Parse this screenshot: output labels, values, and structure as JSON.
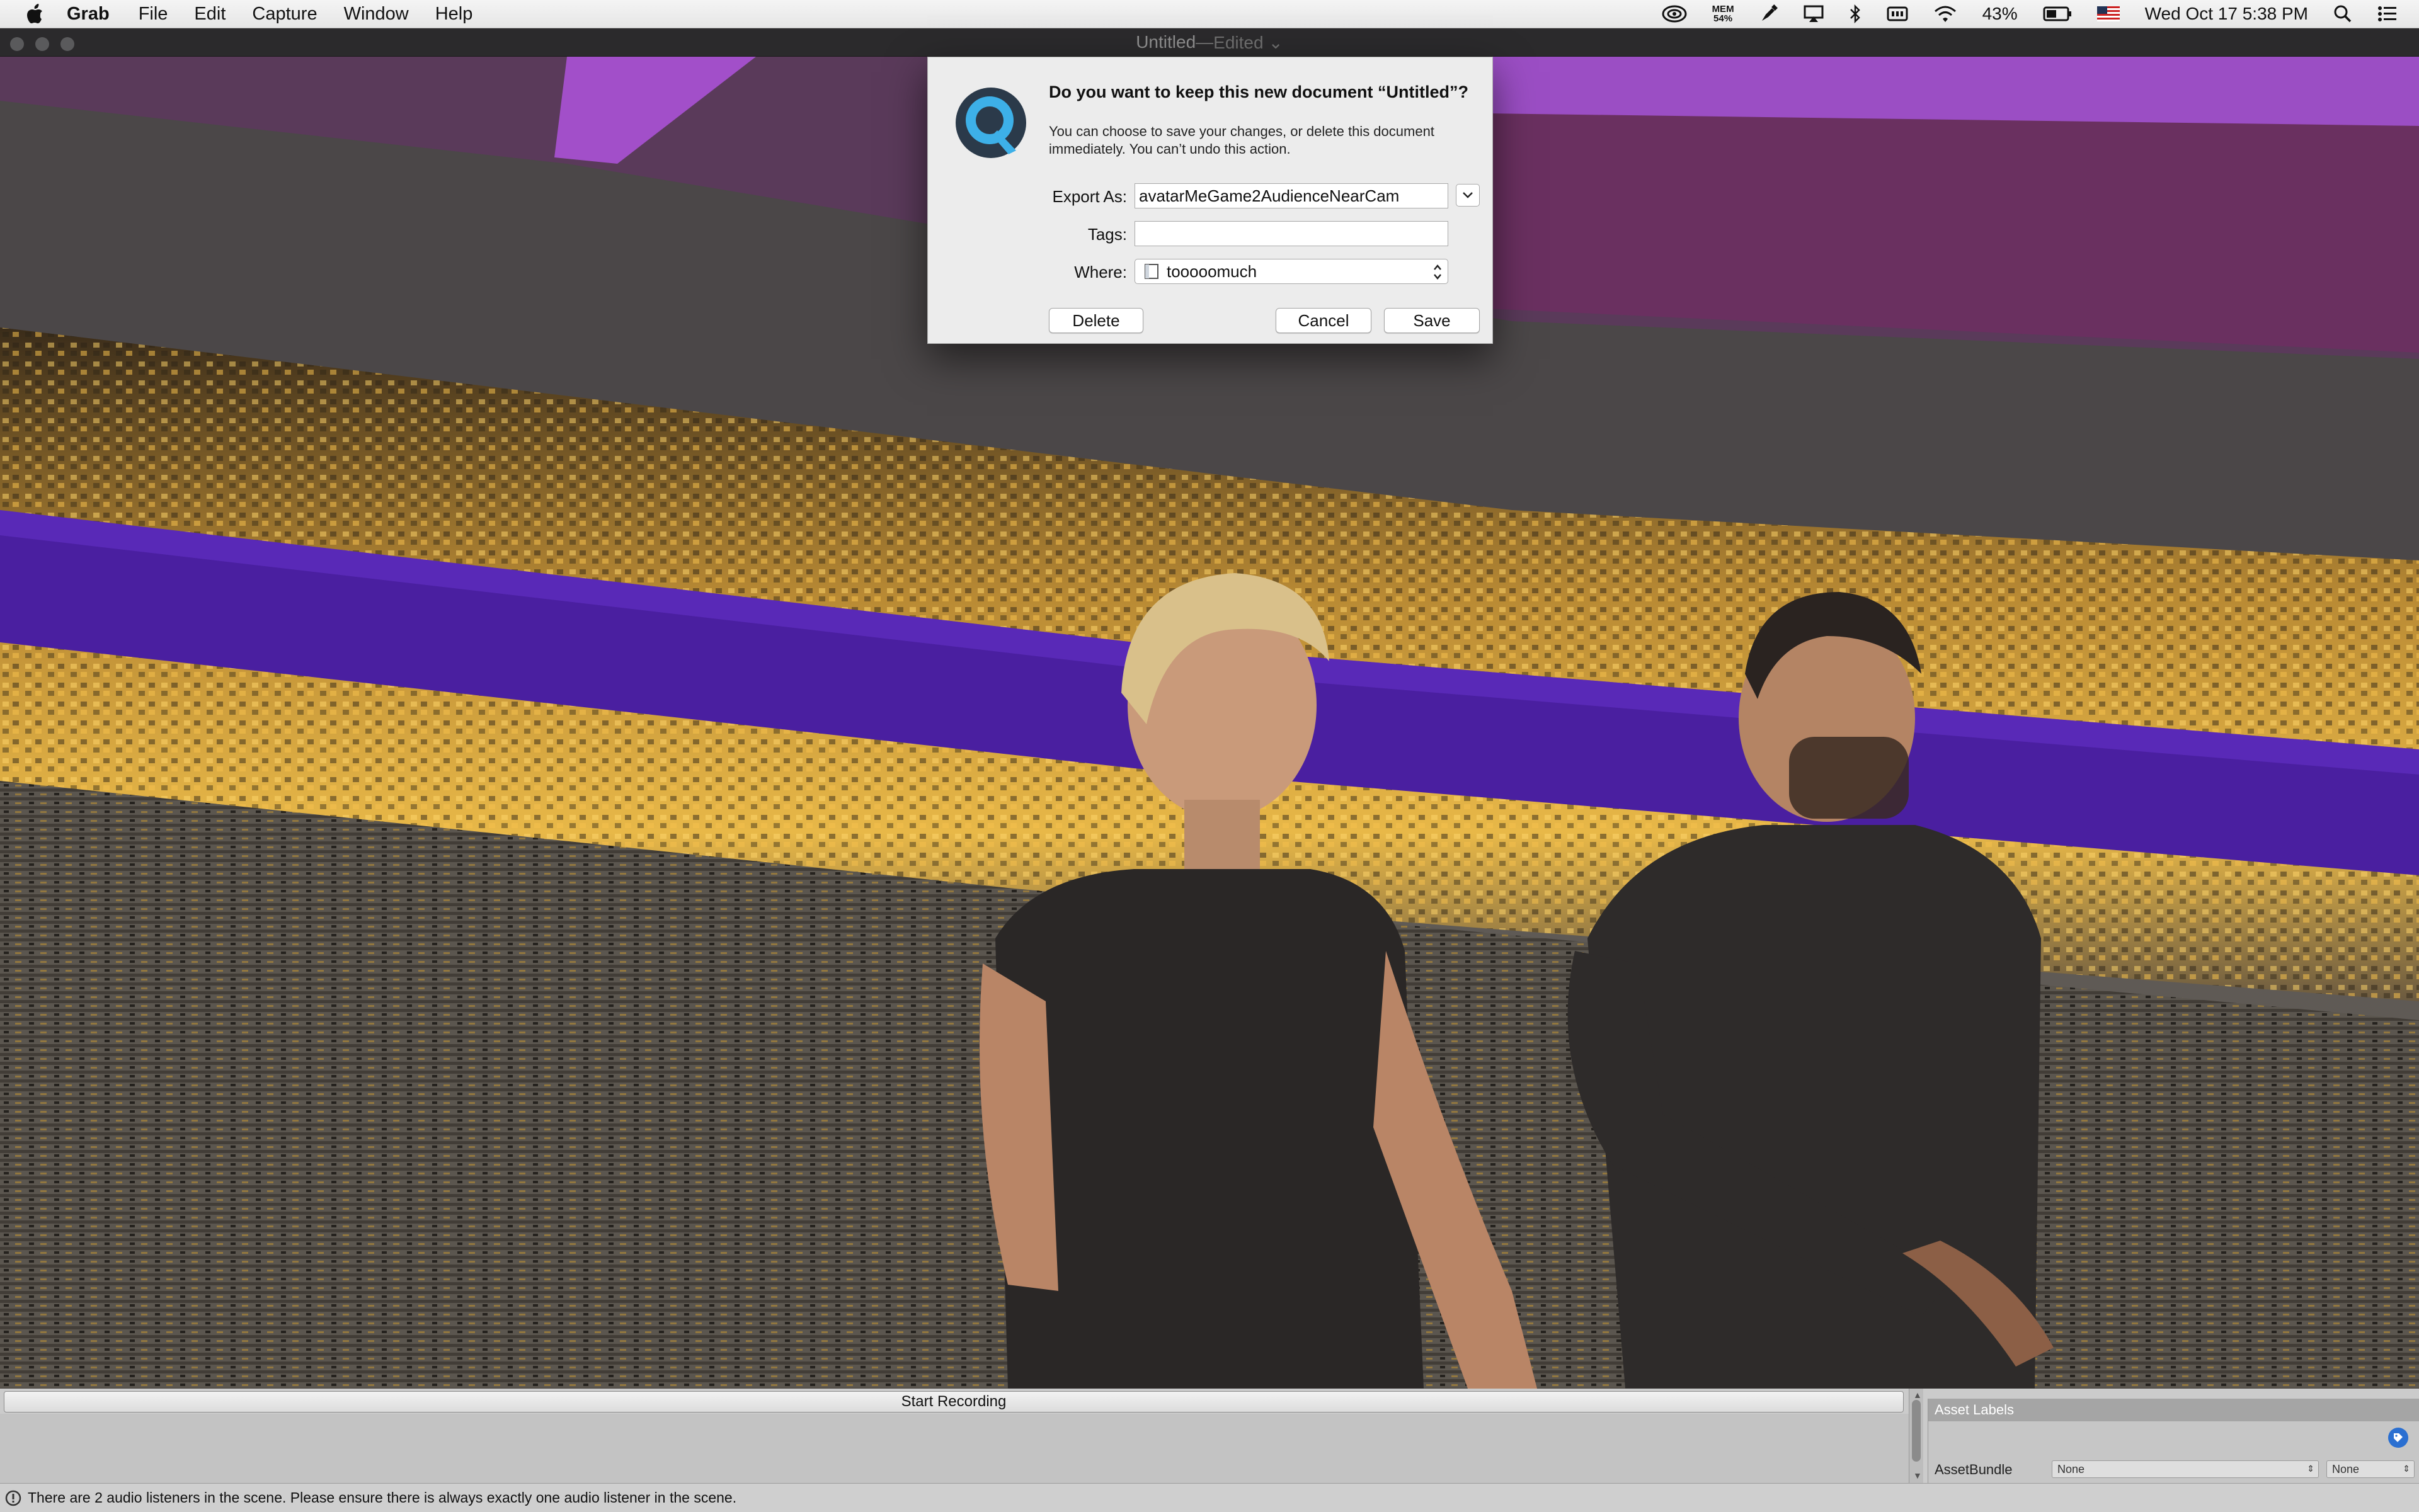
{
  "menubar": {
    "app_name": "Grab",
    "items": [
      "File",
      "Edit",
      "Capture",
      "Window",
      "Help"
    ],
    "mem_label": "MEM",
    "mem_value": "54%",
    "battery": "43%",
    "clock": "Wed Oct 17  5:38 PM",
    "icons": [
      "apple-icon",
      "activity-icon",
      "memory-monitor",
      "pen-icon",
      "airplay-icon",
      "bluetooth-icon",
      "display-icon",
      "wifi-icon",
      "battery-icon",
      "us-flag-icon",
      "spotlight-icon",
      "notification-center-icon"
    ]
  },
  "window": {
    "title": "Untitled",
    "separator": " — ",
    "edited": "Edited ⌄"
  },
  "dialog": {
    "headline": "Do you want to keep this new document “Untitled”?",
    "info": "You can choose to save your changes, or delete this document immediately. You can’t undo this action.",
    "export_label": "Export As:",
    "export_value": "avatarMeGame2AudienceNearCam",
    "tags_label": "Tags:",
    "tags_value": "",
    "where_label": "Where:",
    "where_value": "tooooomuch",
    "delete_label": "Delete",
    "cancel_label": "Cancel",
    "save_label": "Save",
    "icon": "quicktime-icon"
  },
  "bottom_panel": {
    "record_label": "Start Recording",
    "inspector_header": "Asset Labels",
    "assetbundle_label": "AssetBundle",
    "assetbundle_value": "None",
    "variant_value": "None",
    "status_message": "There are 2 audio listeners in the scene. Please ensure there is always exactly one audio listener in the scene."
  },
  "colors": {
    "accent_purple": "#4a1fa0",
    "ceiling_purple": "#9a4cc2",
    "city_gold": "#d9a43a",
    "tag_blue": "#2a6fd1"
  }
}
